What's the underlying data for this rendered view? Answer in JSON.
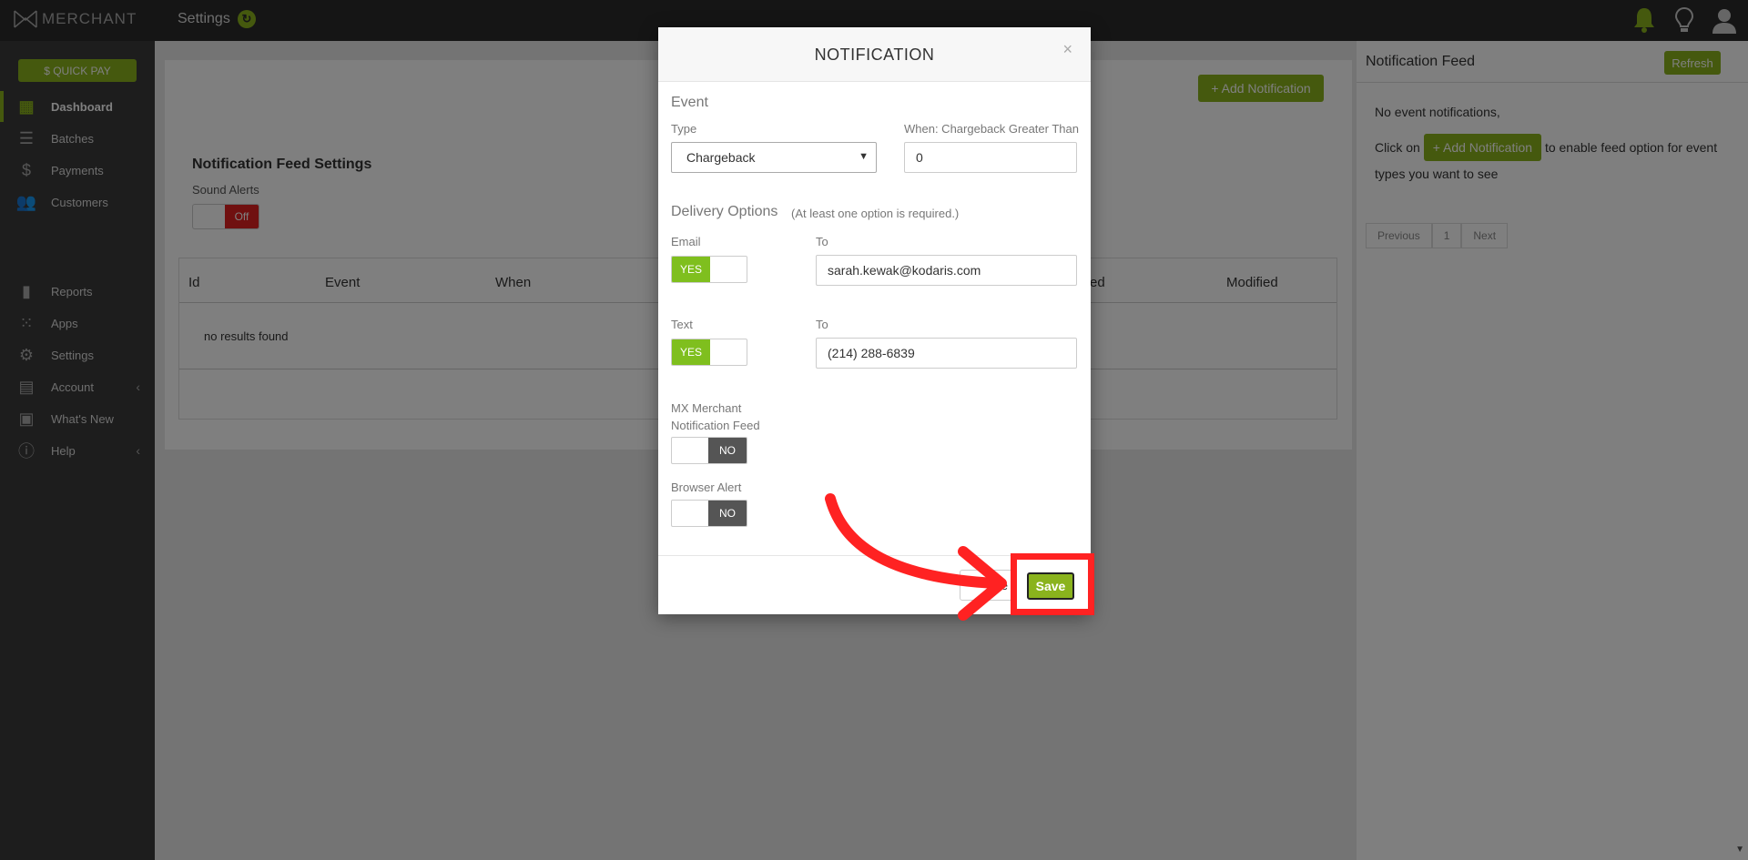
{
  "app": {
    "logo": "MERCHANT",
    "page_title": "Settings"
  },
  "sidebar": {
    "quickpay": "$ QUICK PAY",
    "items": [
      {
        "label": "Dashboard",
        "icon": "dashboard-icon"
      },
      {
        "label": "Batches",
        "icon": "batches-icon"
      },
      {
        "label": "Payments",
        "icon": "dollar-icon"
      },
      {
        "label": "Customers",
        "icon": "customers-icon"
      },
      {
        "label": "Reports",
        "icon": "bar-chart-icon"
      },
      {
        "label": "Apps",
        "icon": "apps-grid-icon"
      },
      {
        "label": "Settings",
        "icon": "gear-icon"
      },
      {
        "label": "Account",
        "icon": "store-icon"
      },
      {
        "label": "What's New",
        "icon": "gift-icon"
      },
      {
        "label": "Help",
        "icon": "help-icon"
      }
    ]
  },
  "main": {
    "add_notification": "+ Add Notification",
    "feed_settings_title": "Notification Feed Settings",
    "sound_alerts_label": "Sound Alerts",
    "sound_alerts_value": "Off",
    "table": {
      "headers": [
        "Id",
        "Event",
        "When",
        "ed",
        "Modified"
      ],
      "empty": "no results found"
    }
  },
  "feed": {
    "title": "Notification Feed",
    "refresh": "Refresh",
    "empty": "No event notifications,",
    "click_on": "Click on",
    "add_notification": "+ Add Notification",
    "after": "to enable feed option for event types you want to see",
    "pager": {
      "previous": "Previous",
      "page": "1",
      "next": "Next"
    }
  },
  "modal": {
    "title": "NOTIFICATION",
    "close": "×",
    "event_section": "Event",
    "type_label": "Type",
    "type_value": "Chargeback",
    "when_label": "When: Chargeback Greater Than",
    "when_value": "0",
    "delivery_section": "Delivery Options",
    "delivery_hint": "(At least one option is required.)",
    "email_label": "Email",
    "email_toggle": "YES",
    "to_label": "To",
    "email_value": "sarah.kewak@kodaris.com",
    "text_label": "Text",
    "text_toggle": "YES",
    "phone_value": "(214) 288-6839",
    "mx_feed_label_1": "MX Merchant",
    "mx_feed_label_2": "Notification Feed",
    "mx_feed_toggle": "NO",
    "browser_alert_label": "Browser Alert",
    "browser_alert_toggle": "NO",
    "cancel": "e",
    "save": "Save"
  },
  "colors": {
    "accent": "#8ab31d",
    "annotation": "#ff2222",
    "off": "#e02020"
  }
}
